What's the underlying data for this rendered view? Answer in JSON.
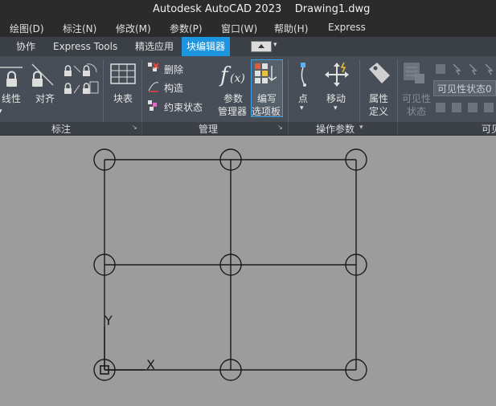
{
  "title": {
    "app": "Autodesk AutoCAD 2023",
    "file": "Drawing1.dwg"
  },
  "menu": [
    "绘图(D)",
    "标注(N)",
    "修改(M)",
    "参数(P)",
    "窗口(W)",
    "帮助(H)",
    "Express"
  ],
  "tabs": [
    {
      "label": "协作",
      "active": false
    },
    {
      "label": "Express Tools",
      "active": false
    },
    {
      "label": "精选应用",
      "active": false
    },
    {
      "label": "块编辑器",
      "active": true
    }
  ],
  "ribbon": {
    "dim_panel": {
      "linear_label": "线性",
      "align_label": "对齐",
      "footer": "标注"
    },
    "block_table_label": "块表",
    "manage_panel": {
      "delete_label": "删除",
      "construct_label": "构造",
      "constraint_state_label": "约束状态",
      "param_manager_line1": "参数",
      "param_manager_line2": "管理器",
      "write_palette_line1": "编写",
      "write_palette_line2": "选项板",
      "footer": "管理"
    },
    "action_panel": {
      "point_label": "点",
      "move_label": "移动",
      "footer": "操作参数"
    },
    "attr_def_line1": "属性",
    "attr_def_line2": "定义",
    "visibility": {
      "state_line1": "可见性",
      "state_line2": "状态",
      "state_value": "可见性状态0",
      "footer": "可见"
    }
  },
  "drawing": {
    "y_axis_label": "Y",
    "x_axis_label": "X"
  }
}
